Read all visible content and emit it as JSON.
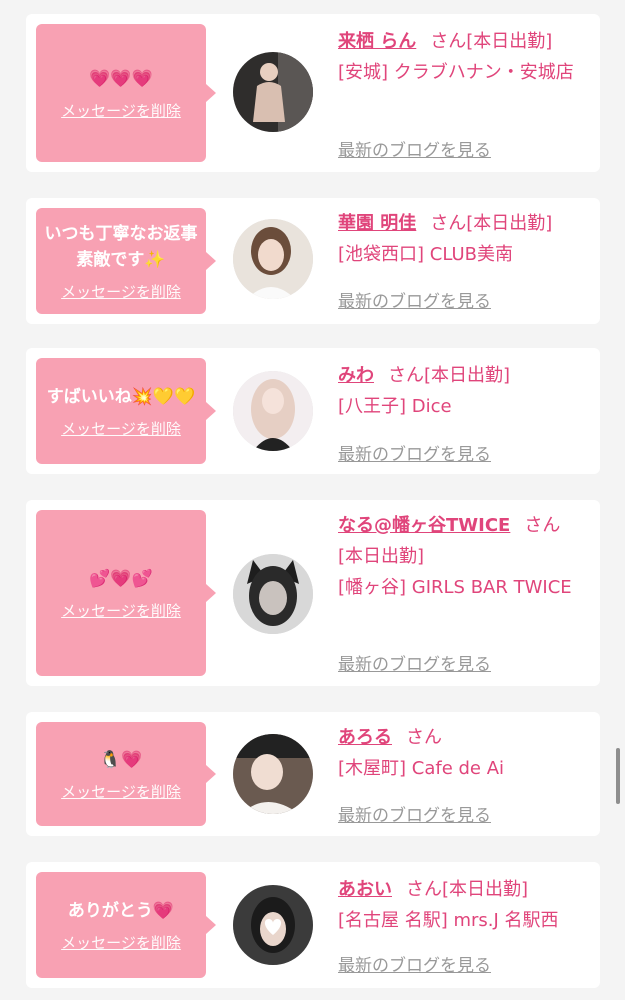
{
  "ui": {
    "delete_label": "メッセージを削除",
    "blog_label": "最新のブログを見る"
  },
  "cards": [
    {
      "message": "💗💗💗",
      "name": "来栖 らん",
      "honorific": "さん",
      "status": "[本日出勤]",
      "store": "[安城] クラブハナン・安城店"
    },
    {
      "message": "いつも丁寧なお返事素敵です✨",
      "name": "華園 明佳",
      "honorific": "さん",
      "status": "[本日出勤]",
      "store": "[池袋西口] CLUB美南"
    },
    {
      "message": "すばいいね💥💛💛",
      "name": "みわ",
      "honorific": "さん",
      "status": "[本日出勤]",
      "store": "[八王子] Dice"
    },
    {
      "message": "💕💗💕",
      "name": "なる@幡ヶ谷TWICE",
      "honorific": "さん",
      "status": "[本日出勤]",
      "store": "[幡ヶ谷] GIRLS BAR TWICE"
    },
    {
      "message": "🐧💗",
      "name": "あろる",
      "honorific": "さん",
      "status": "",
      "store": "[木屋町] Cafe de Ai"
    },
    {
      "message": "ありがとう💗",
      "name": "あおい",
      "honorific": "さん",
      "status": "[本日出勤]",
      "store": "[名古屋 名駅] mrs.J 名駅西"
    }
  ]
}
